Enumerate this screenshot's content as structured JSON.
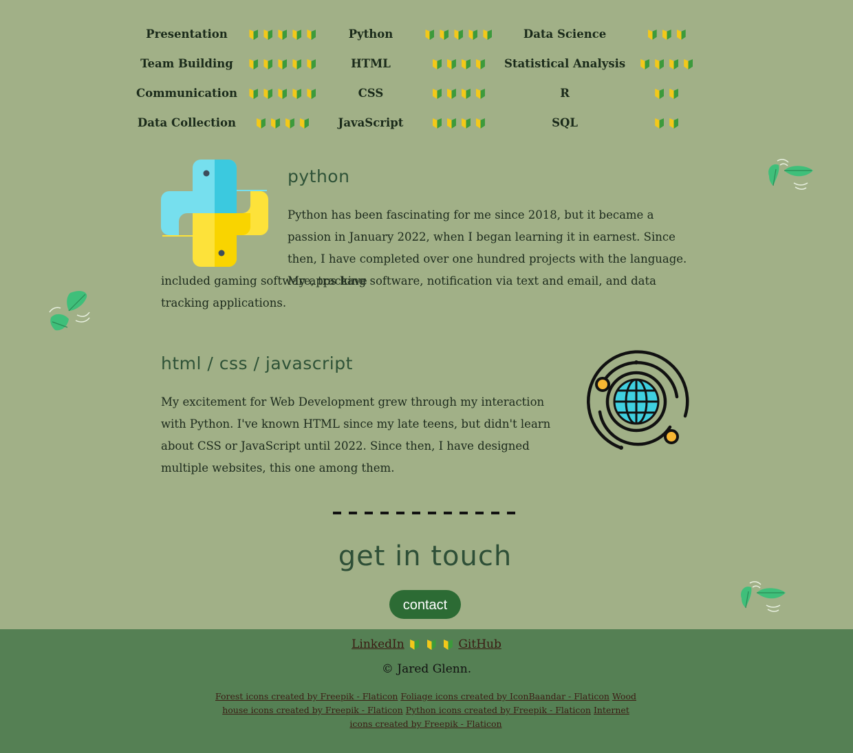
{
  "skills": {
    "rows": [
      [
        {
          "name": "Presentation",
          "level": 5
        },
        {
          "name": "Python",
          "level": 5
        },
        {
          "name": "Data Science",
          "level": 3
        }
      ],
      [
        {
          "name": "Team Building",
          "level": 5
        },
        {
          "name": "HTML",
          "level": 4
        },
        {
          "name": "Statistical Analysis",
          "level": 4
        }
      ],
      [
        {
          "name": "Communication",
          "level": 5
        },
        {
          "name": "CSS",
          "level": 4
        },
        {
          "name": "R",
          "level": 2
        }
      ],
      [
        {
          "name": "Data Collection",
          "level": 4
        },
        {
          "name": "JavaScript",
          "level": 4
        },
        {
          "name": "SQL",
          "level": 2
        }
      ]
    ],
    "level_icon": "beginner-mark-icon"
  },
  "python": {
    "title": "python",
    "para1": "Python has been fascinating for me since 2018, but it became a passion in January 2022, when I began learning it in earnest. Since then, I have completed over one hundred projects with the language. My apps have",
    "para2": "included gaming software, tracking software, notification via text and email, and data tracking applications."
  },
  "web": {
    "title": "html / css / javascript",
    "para": "My excitement for Web Development grew through my interaction with Python. I've known HTML since my late teens, but didn't learn about CSS or JavaScript until 2022. Since then, I have designed multiple websites, this one among them."
  },
  "contact": {
    "heading": "get in touch",
    "button": "contact"
  },
  "footer": {
    "linkedin": "LinkedIn",
    "github": "GitHub",
    "copyright": "© Jared Glenn.",
    "credits": [
      "Forest icons created by Freepik - Flaticon",
      "Foliage icons created by IconBaandar - Flaticon",
      "Wood house icons created by Freepik - Flaticon",
      "Python icons created by Freepik - Flaticon",
      "Internet icons created by Freepik - Flaticon"
    ]
  },
  "colors": {
    "background": "#a1b087",
    "footer": "#558054",
    "heading": "#2e5237",
    "button": "#2c6b34",
    "link": "#3a1a12"
  }
}
